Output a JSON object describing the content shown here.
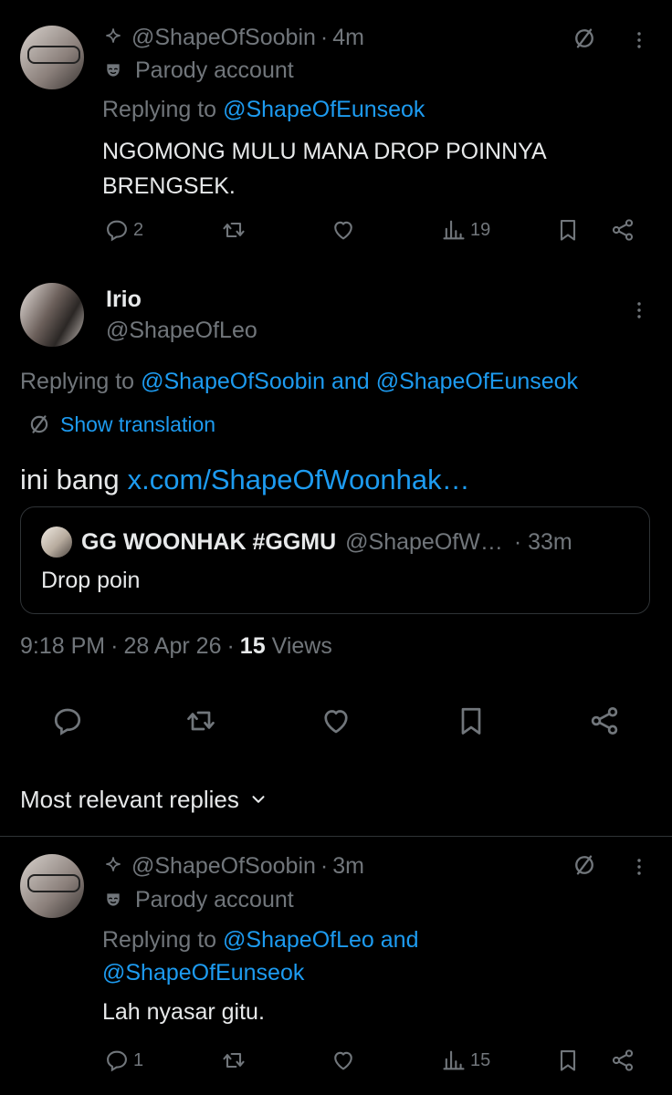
{
  "reply1": {
    "handle": "@ShapeOfSoobin",
    "time": "4m",
    "label": "Parody account",
    "replying_prefix": "Replying to",
    "replying_to": "@ShapeOfEunseok",
    "text": "NGOMONG MULU MANA DROP POINNYA BRENGSEK.",
    "replies": "2",
    "views": "19"
  },
  "main": {
    "name": "Irio",
    "handle": "@ShapeOfLeo",
    "replying_prefix": "Replying to",
    "replying_user1": "@ShapeOfSoobin",
    "replying_and": "and",
    "replying_user2": "@ShapeOfEunseok",
    "show_translation": "Show translation",
    "text_prefix": "ini bang",
    "text_link": "x.com/ShapeOfWoonhak…",
    "quote": {
      "name": "GG WOONHAK #GGMU",
      "handle": "@ShapeOfW…",
      "time": "· 33m",
      "text": "Drop poin"
    },
    "meta_time": "9:18 PM",
    "meta_date": "28 Apr 26",
    "views_count": "15",
    "views_label": "Views"
  },
  "sort_label": "Most relevant replies",
  "reply2": {
    "handle": "@ShapeOfSoobin",
    "time": "3m",
    "label": "Parody account",
    "replying_prefix": "Replying to",
    "replying_user1": "@ShapeOfLeo",
    "replying_and": "and",
    "replying_user2": "@ShapeOfEunseok",
    "text": "Lah nyasar gitu.",
    "replies": "1",
    "views": "15"
  },
  "colors": {
    "background": "#000000",
    "text": "#e7e9ea",
    "muted": "#71767b",
    "link": "#1d9bf0",
    "divider": "#2f3336"
  }
}
